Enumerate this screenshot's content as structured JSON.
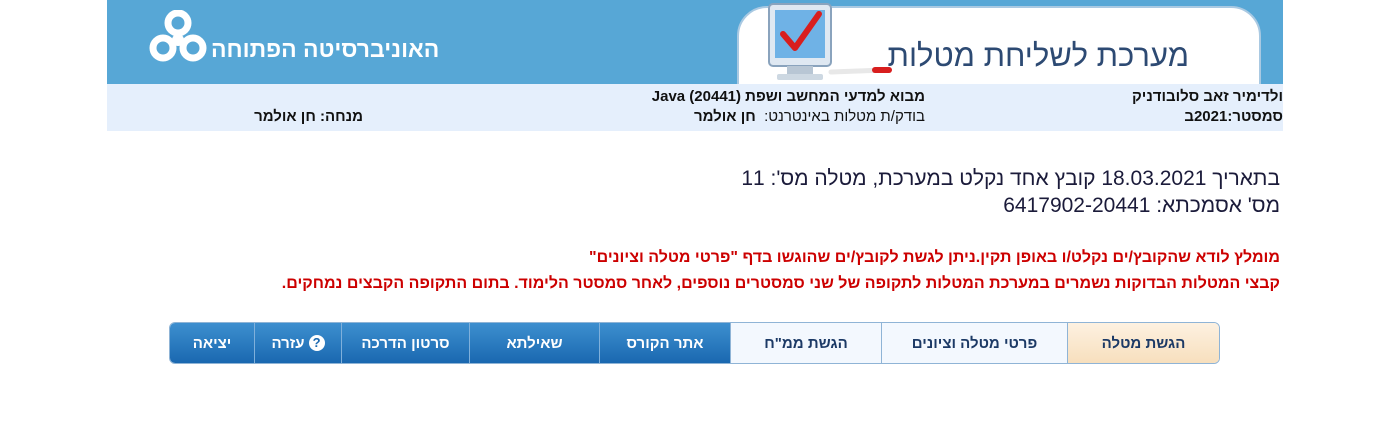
{
  "header": {
    "university_name": "האוניברסיטה הפתוחה",
    "system_title": "מערכת לשליחת מטלות"
  },
  "info_bar": {
    "student_name": "ולדימיר זאב סלובודניק",
    "semester_label": "סמסטר:",
    "semester_value": "2021ב",
    "course_name": "מבוא למדעי המחשב ושפת Java (20441)",
    "checker_label": "בודק/ת מטלות באינטרנט:",
    "checker_name": "חן אולמר",
    "tutor_label": "מנחה:",
    "tutor_name": "חן אולמר"
  },
  "confirmation": {
    "line1": "בתאריך 18.03.2021 קובץ אחד נקלט במערכת, מטלה מס': 11",
    "line2": "מס' אסמכתא: 6417902-20441"
  },
  "notice": {
    "line1": "מומלץ לודא שהקובץ/ים נקלט/ו באופן תקין.ניתן לגשת לקובץ/ים שהוגשו בדף \"פרטי מטלה וציונים\"",
    "line2": "קבצי המטלות הבדוקות נשמרים במערכת המטלות לתקופה של שני סמסטרים נוספים, לאחר סמסטר הלימוד. בתום התקופה הקבצים נמחקים."
  },
  "nav": {
    "exit": "יציאה",
    "help_icon_glyph": "?",
    "help": "עזרה",
    "tutorial_video": "סרטון הדרכה",
    "sheilta": "שאילתא",
    "course_site": "אתר הקורס",
    "submit_mmn": "הגשת ממ\"ח",
    "assignment_details": "פרטי מטלה וציונים",
    "submit_assignment": "הגשת מטלה"
  },
  "colors": {
    "header_bg": "#57a7d6",
    "info_bar_bg": "#e5effc",
    "notice_red": "#cc0000",
    "nav_dark": "#1a68b0",
    "nav_active": "#f7dfbd"
  },
  "icons": {
    "logo": "open-university-logo-icon",
    "monitor": "monitor-checkmark-icon",
    "help": "question-circle-icon"
  }
}
